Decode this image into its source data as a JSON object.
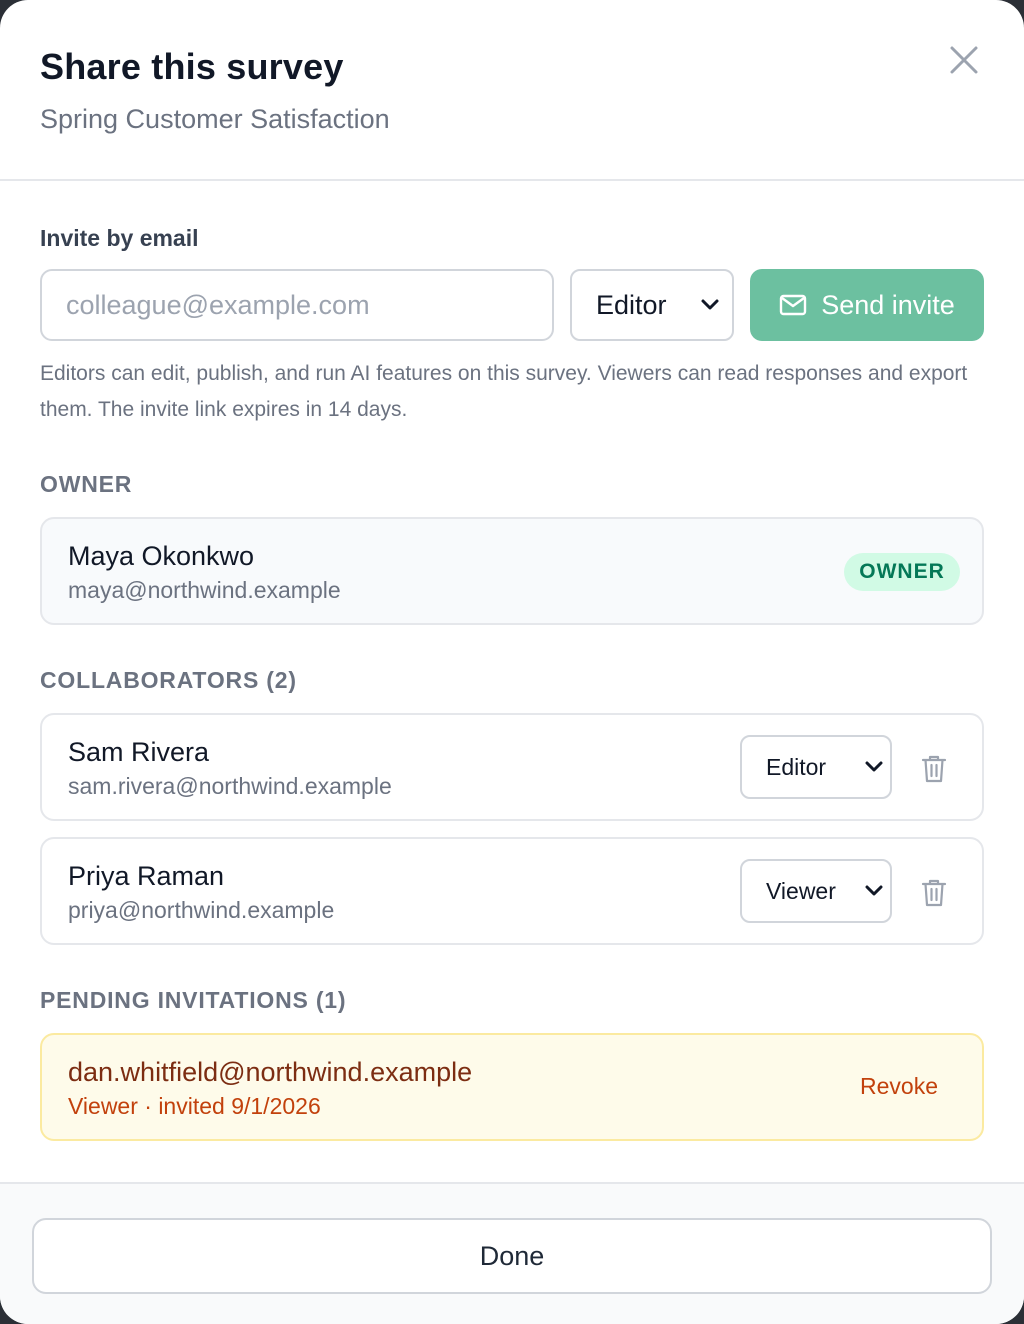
{
  "header": {
    "title": "Share this survey",
    "subtitle": "Spring Customer Satisfaction",
    "close_icon": "close-icon"
  },
  "invite": {
    "label": "Invite by email",
    "email_placeholder": "colleague@example.com",
    "email_value": "",
    "role_selected": "Editor",
    "send_label": "Send invite",
    "send_icon": "mail-icon",
    "help_text": "Editors can edit, publish, and run AI features on this survey. Viewers can read responses and export them. The invite link expires in 14 days."
  },
  "owner_section": {
    "heading": "OWNER",
    "name": "Maya Okonkwo",
    "email": "maya@northwind.example",
    "badge": "OWNER"
  },
  "collaborators_section": {
    "heading": "COLLABORATORS (2)",
    "items": [
      {
        "name": "Sam Rivera",
        "email": "sam.rivera@northwind.example",
        "role": "Editor",
        "delete_icon": "trash-icon"
      },
      {
        "name": "Priya Raman",
        "email": "priya@northwind.example",
        "role": "Viewer",
        "delete_icon": "trash-icon"
      }
    ]
  },
  "pending_section": {
    "heading": "PENDING INVITATIONS (1)",
    "items": [
      {
        "email": "dan.whitfield@northwind.example",
        "meta": "Viewer · invited 9/1/2026",
        "action": "Revoke"
      }
    ]
  },
  "footer": {
    "done_label": "Done"
  },
  "colors": {
    "accent": "#6cc0a0",
    "owner_badge_bg": "#d1fae5",
    "owner_badge_text": "#047857",
    "pending_bg": "#fefbea",
    "pending_text": "#c2410c"
  }
}
